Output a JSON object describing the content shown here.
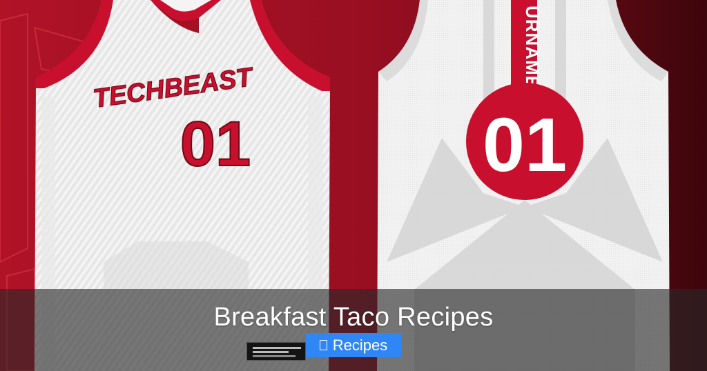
{
  "image": {
    "left_jersey": {
      "team_name": "TECHBEAST",
      "number": "01"
    },
    "right_jersey": {
      "player_name": "URNAME",
      "number": "01"
    }
  },
  "overlay": {
    "title": "Breakfast Taco Recipes",
    "category_button": {
      "label": "Recipes",
      "icon": "folder-icon"
    }
  },
  "colors": {
    "jersey_red": "#c8102e",
    "background_red": "#8a0f1e",
    "button_blue": "#2f86f5"
  }
}
